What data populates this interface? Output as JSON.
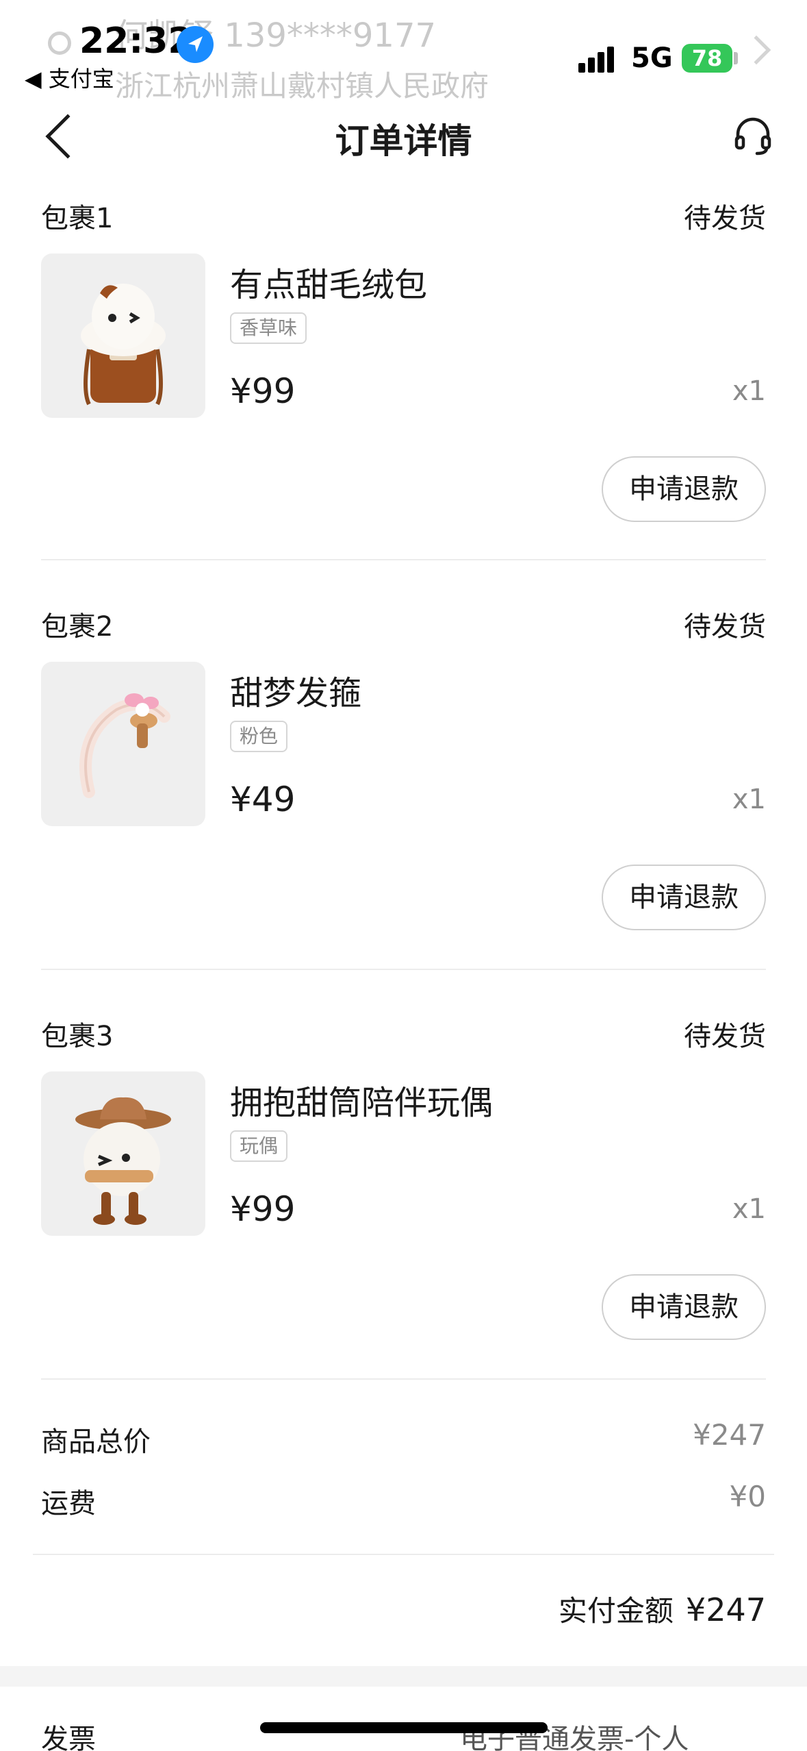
{
  "background_header": {
    "name_phone": "何凯铎 139****9177",
    "address": "浙江杭州萧山戴村镇人民政府"
  },
  "status_bar": {
    "time": "22:32",
    "back_app": "◀ 支付宝",
    "network": "5G",
    "battery": "78"
  },
  "nav": {
    "title": "订单详情",
    "back_icon": "chevron-left-icon",
    "service_icon": "headset-icon"
  },
  "packages": [
    {
      "name": "包裹1",
      "status": "待发货",
      "product": "有点甜毛绒包",
      "variant": "香草味",
      "price": "¥99",
      "qty": "x1",
      "refund_label": "申请退款"
    },
    {
      "name": "包裹2",
      "status": "待发货",
      "product": "甜梦发箍",
      "variant": "粉色",
      "price": "¥49",
      "qty": "x1",
      "refund_label": "申请退款"
    },
    {
      "name": "包裹3",
      "status": "待发货",
      "product": "拥抱甜筒陪伴玩偶",
      "variant": "玩偶",
      "price": "¥99",
      "qty": "x1",
      "refund_label": "申请退款"
    }
  ],
  "summary": {
    "goods_total_label": "商品总价",
    "goods_total_value": "¥247",
    "shipping_label": "运费",
    "shipping_value": "¥0",
    "paid_label": "实付金额",
    "paid_value": "¥247"
  },
  "invoice": {
    "label": "发票",
    "value": "电子普通发票-个人"
  },
  "colors": {
    "battery_green": "#34c759",
    "location_blue": "#1a8cff",
    "text_primary": "#1a1a1a",
    "text_secondary": "#8a8a8a"
  }
}
